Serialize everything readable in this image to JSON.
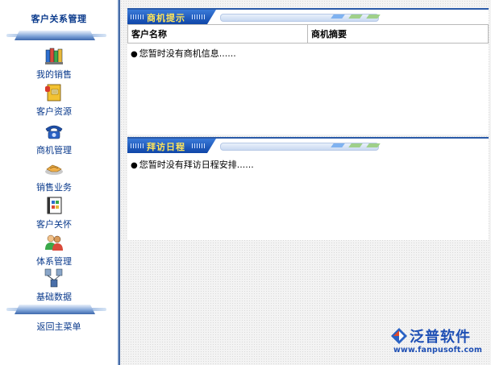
{
  "sidebar": {
    "title": "客户关系管理",
    "items": [
      {
        "label": "我的销售",
        "icon": "books-icon"
      },
      {
        "label": "客户资源",
        "icon": "phonebook-icon"
      },
      {
        "label": "商机管理",
        "icon": "telephone-icon"
      },
      {
        "label": "销售业务",
        "icon": "handshake-icon"
      },
      {
        "label": "客户关怀",
        "icon": "notebook-icon"
      },
      {
        "label": "体系管理",
        "icon": "users-icon"
      },
      {
        "label": "基础数据",
        "icon": "network-icon"
      }
    ],
    "back_label": "返回主菜单"
  },
  "panels": {
    "opportunity": {
      "title": "商机提示",
      "columns": [
        "客户名称",
        "商机摘要"
      ],
      "empty_text": "您暂时没有商机信息......"
    },
    "visit": {
      "title": "拜访日程",
      "empty_text": "您暂时没有拜访日程安排......"
    }
  },
  "logo": {
    "name": "泛普软件",
    "url": "www.fanpusoft.com"
  },
  "colors": {
    "nav_text": "#0a3a8c",
    "panel_header": "#1a56c0",
    "panel_title": "#ffe55a",
    "logo": "#1e4fb4"
  }
}
